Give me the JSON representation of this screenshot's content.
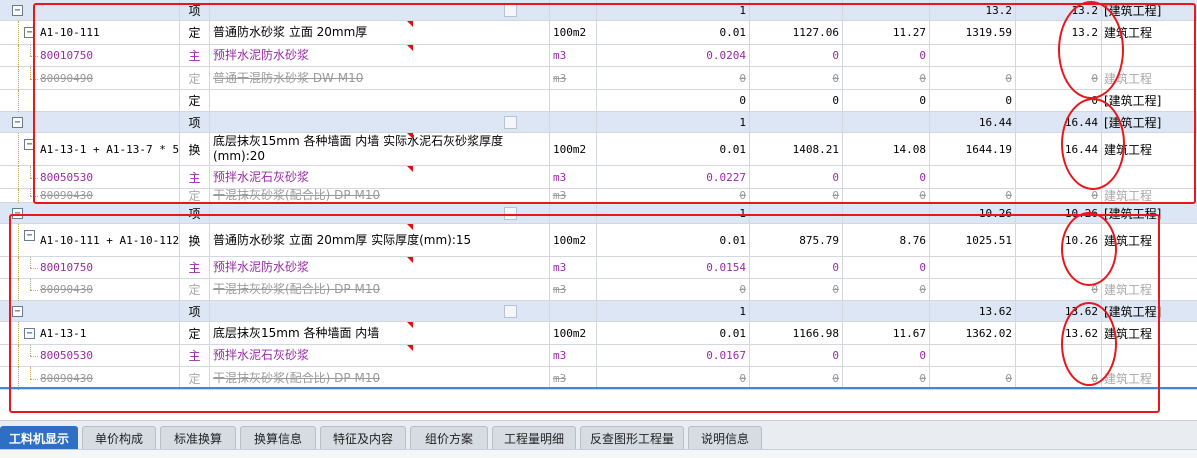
{
  "grid": {
    "rows": [
      {
        "kind": "group",
        "code": "",
        "type": "项",
        "name": "",
        "unit": "",
        "qty": "1",
        "p1": "",
        "p2": "",
        "p3": "13.2",
        "p4": "13.2",
        "prof": "[建筑工程]"
      },
      {
        "kind": "item",
        "code": "A1-10-111",
        "type": "定",
        "name": "普通防水砂浆 立面 20mm厚",
        "unit": "100m2",
        "qty": "0.01",
        "p1": "1127.06",
        "p2": "11.27",
        "p3": "1319.59",
        "p4": "13.2",
        "prof": "建筑工程"
      },
      {
        "kind": "main",
        "code": "80010750",
        "type": "主",
        "name": "预拌水泥防水砂浆",
        "unit": "m3",
        "qty": "0.0204",
        "p1": "0",
        "p2": "0",
        "p3": "",
        "p4": "",
        "prof": ""
      },
      {
        "kind": "strike",
        "code": "80090490",
        "type": "定",
        "name": "普通干混防水砂浆 DW M10",
        "unit": "m3",
        "qty": "0",
        "p1": "0",
        "p2": "0",
        "p3": "0",
        "p4": "0",
        "prof": "建筑工程"
      },
      {
        "kind": "item",
        "code": "",
        "type": "定",
        "name": "",
        "unit": "",
        "qty": "0",
        "p1": "0",
        "p2": "0",
        "p3": "0",
        "p4": "0",
        "prof": "[建筑工程]"
      },
      {
        "kind": "group",
        "code": "",
        "type": "项",
        "name": "",
        "unit": "",
        "qty": "1",
        "p1": "",
        "p2": "",
        "p3": "16.44",
        "p4": "16.44",
        "prof": "[建筑工程]"
      },
      {
        "kind": "item",
        "code": "A1-13-1 + A1-13-7 * 5",
        "type": "换",
        "name": "底层抹灰15mm 各种墙面 内墙  实际水泥石灰砂浆厚度(mm):20",
        "unit": "100m2",
        "qty": "0.01",
        "p1": "1408.21",
        "p2": "14.08",
        "p3": "1644.19",
        "p4": "16.44",
        "prof": "建筑工程"
      },
      {
        "kind": "main",
        "code": "80050530",
        "type": "主",
        "name": "预拌水泥石灰砂浆",
        "unit": "m3",
        "qty": "0.0227",
        "p1": "0",
        "p2": "0",
        "p3": "",
        "p4": "",
        "prof": ""
      },
      {
        "kind": "strike",
        "code": "80090430",
        "type": "定",
        "name": "干混抹灰砂浆(配合比) DP M10",
        "unit": "m3",
        "qty": "0",
        "p1": "0",
        "p2": "0",
        "p3": "0",
        "p4": "0",
        "prof": "建筑工程"
      },
      {
        "kind": "group",
        "code": "",
        "type": "项",
        "name": "",
        "unit": "",
        "qty": "1",
        "p1": "",
        "p2": "",
        "p3": "10.26",
        "p4": "10.26",
        "prof": "[建筑工程]"
      },
      {
        "kind": "item",
        "code": "A1-10-111 + A1-10-112 * -1",
        "type": "换",
        "name": "普通防水砂浆 立面 20mm厚  实际厚度(mm):15",
        "unit": "100m2",
        "qty": "0.01",
        "p1": "875.79",
        "p2": "8.76",
        "p3": "1025.51",
        "p4": "10.26",
        "prof": "建筑工程"
      },
      {
        "kind": "main",
        "code": "80010750",
        "type": "主",
        "name": "预拌水泥防水砂浆",
        "unit": "m3",
        "qty": "0.0154",
        "p1": "0",
        "p2": "0",
        "p3": "",
        "p4": "",
        "prof": ""
      },
      {
        "kind": "strike",
        "code": "80090430",
        "type": "定",
        "name": "干混抹灰砂浆(配合比) DP M10",
        "unit": "m3",
        "qty": "0",
        "p1": "0",
        "p2": "0",
        "p3": "",
        "p4": "0",
        "prof": "建筑工程"
      },
      {
        "kind": "group",
        "code": "",
        "type": "项",
        "name": "",
        "unit": "",
        "qty": "1",
        "p1": "",
        "p2": "",
        "p3": "13.62",
        "p4": "13.62",
        "prof": "[建筑工程]"
      },
      {
        "kind": "item",
        "code": "A1-13-1",
        "type": "定",
        "name": "底层抹灰15mm 各种墙面 内墙",
        "unit": "100m2",
        "qty": "0.01",
        "p1": "1166.98",
        "p2": "11.67",
        "p3": "1362.02",
        "p4": "13.62",
        "prof": "建筑工程"
      },
      {
        "kind": "main",
        "code": "80050530",
        "type": "主",
        "name": "预拌水泥石灰砂浆",
        "unit": "m3",
        "qty": "0.0167",
        "p1": "0",
        "p2": "0",
        "p3": "",
        "p4": "",
        "prof": ""
      },
      {
        "kind": "strike",
        "code": "80090430",
        "type": "定",
        "name": "干混抹灰砂浆(配合比) DP M10",
        "unit": "m3",
        "qty": "0",
        "p1": "0",
        "p2": "0",
        "p3": "0",
        "p4": "0",
        "prof": "建筑工程"
      }
    ]
  },
  "tabs": [
    {
      "label": "工料机显示",
      "active": true
    },
    {
      "label": "单价构成",
      "active": false
    },
    {
      "label": "标准换算",
      "active": false
    },
    {
      "label": "换算信息",
      "active": false
    },
    {
      "label": "特征及内容",
      "active": false
    },
    {
      "label": "组价方案",
      "active": false
    },
    {
      "label": "工程量明细",
      "active": false
    },
    {
      "label": "反查图形工程量",
      "active": false
    },
    {
      "label": "说明信息",
      "active": false
    }
  ],
  "icons": {
    "expand": "minus-box-icon",
    "corner": "red-corner-marker-icon",
    "checkbox": "checkbox-icon"
  },
  "colors": {
    "group_row": "#dce6f4",
    "material_text": "#9a2aa8",
    "annotation": "#e8171b",
    "active_tab": "#2c6fc4"
  }
}
